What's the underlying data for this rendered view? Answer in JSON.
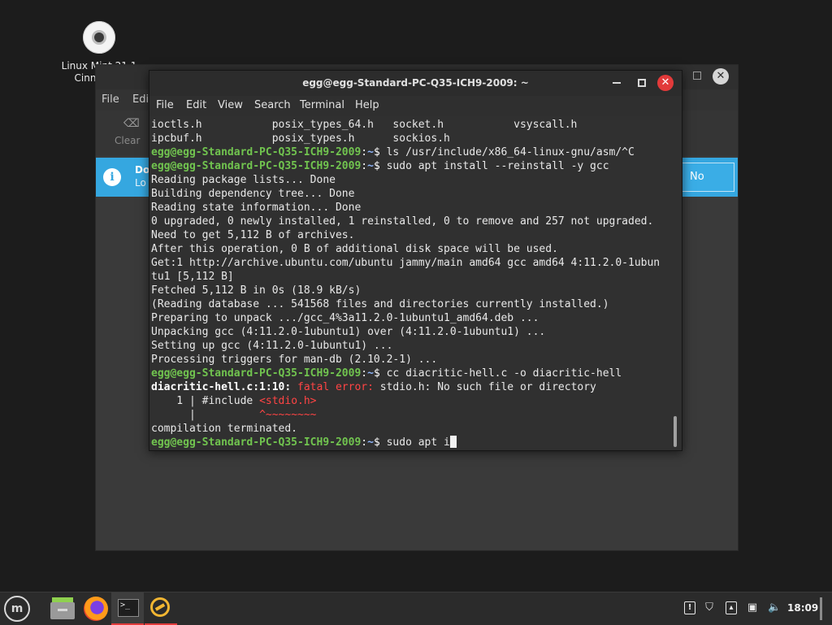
{
  "desktop": {
    "icon_label_line1": "Linux Mint 21.1",
    "icon_label_line2": "Cinnamon"
  },
  "background_window": {
    "menu": [
      "File",
      "Edit"
    ],
    "toolbar_clear": "Clear",
    "info_title": "Do",
    "info_sub": "Lo",
    "no_button": "No"
  },
  "terminal": {
    "title": "egg@egg-Standard-PC-Q35-ICH9-2009: ~",
    "menu": [
      "File",
      "Edit",
      "View",
      "Search",
      "Terminal",
      "Help"
    ],
    "prompt_user": "egg@egg-Standard-PC-Q35-ICH9-2009",
    "prompt_path": "~",
    "files_row1": "ioctls.h           posix_types_64.h   socket.h           vsyscall.h",
    "files_row2": "ipcbuf.h           posix_types.h      sockios.h",
    "cmd1": " ls /usr/include/x86_64-linux-gnu/asm/^C",
    "cmd2": " sudo apt install --reinstall -y gcc",
    "out": [
      "Reading package lists... Done",
      "Building dependency tree... Done",
      "Reading state information... Done",
      "0 upgraded, 0 newly installed, 1 reinstalled, 0 to remove and 257 not upgraded.",
      "Need to get 5,112 B of archives.",
      "After this operation, 0 B of additional disk space will be used.",
      "Get:1 http://archive.ubuntu.com/ubuntu jammy/main amd64 gcc amd64 4:11.2.0-1ubun",
      "tu1 [5,112 B]",
      "Fetched 5,112 B in 0s (18.9 kB/s)",
      "(Reading database ... 541568 files and directories currently installed.)",
      "Preparing to unpack .../gcc_4%3a11.2.0-1ubuntu1_amd64.deb ...",
      "Unpacking gcc (4:11.2.0-1ubuntu1) over (4:11.2.0-1ubuntu1) ...",
      "Setting up gcc (4:11.2.0-1ubuntu1) ...",
      "Processing triggers for man-db (2.10.2-1) ..."
    ],
    "cmd3": " cc diacritic-hell.c -o diacritic-hell",
    "err_loc": "diacritic-hell.c:1:10:",
    "err_label": " fatal error:",
    "err_msg": " stdio.h: No such file or directory",
    "src_prefix": "    1 | #include ",
    "src_hl": "<stdio.h>",
    "caret_prefix": "      |          ",
    "caret": "^~~~~~~~~",
    "compilation": "compilation terminated.",
    "cmd4": " sudo apt i"
  },
  "taskbar": {
    "clock": "18:09",
    "icons": [
      "mint-menu-icon",
      "files-icon",
      "firefox-icon",
      "terminal-icon",
      "app-icon",
      "notes-icon",
      "shield-icon",
      "drive-icon",
      "network-icon",
      "volume-icon"
    ]
  }
}
